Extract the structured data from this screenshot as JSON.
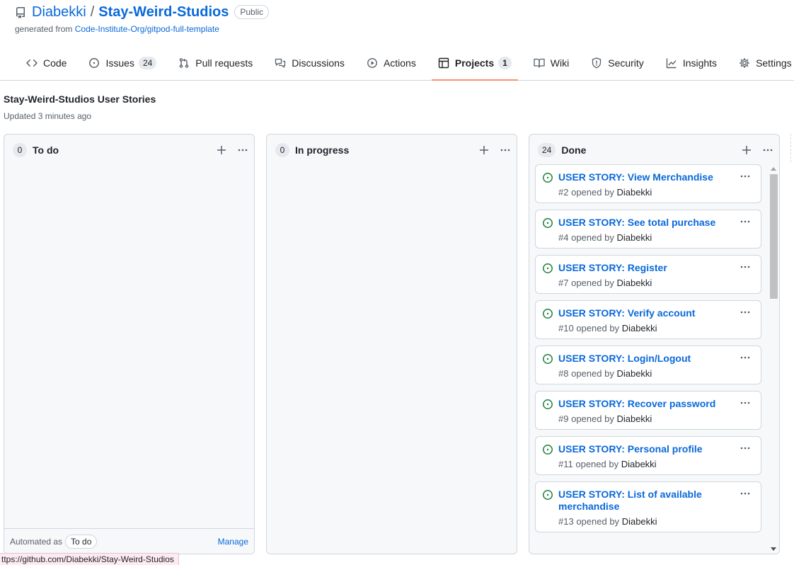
{
  "repo": {
    "owner": "Diabekki",
    "separator": "/",
    "name": "Stay-Weird-Studios",
    "visibility": "Public",
    "generated_prefix": "generated from",
    "generated_from": "Code-Institute-Org/gitpod-full-template"
  },
  "tabs": [
    {
      "label": "Code",
      "icon": "code-icon"
    },
    {
      "label": "Issues",
      "count": "24",
      "icon": "issue-opened-icon"
    },
    {
      "label": "Pull requests",
      "icon": "git-pull-request-icon"
    },
    {
      "label": "Discussions",
      "icon": "comment-discussion-icon"
    },
    {
      "label": "Actions",
      "icon": "play-icon"
    },
    {
      "label": "Projects",
      "count": "1",
      "icon": "table-icon",
      "active": true
    },
    {
      "label": "Wiki",
      "icon": "book-icon"
    },
    {
      "label": "Security",
      "icon": "shield-icon"
    },
    {
      "label": "Insights",
      "icon": "graph-icon"
    },
    {
      "label": "Settings",
      "icon": "gear-icon"
    }
  ],
  "project": {
    "title": "Stay-Weird-Studios User Stories",
    "updated": "Updated 3 minutes ago"
  },
  "columns": [
    {
      "name": "To do",
      "count": "0",
      "automation_label": "Automated as",
      "automation_value": "To do",
      "manage_label": "Manage",
      "cards": []
    },
    {
      "name": "In progress",
      "count": "0",
      "cards": []
    },
    {
      "name": "Done",
      "count": "24",
      "cards": [
        {
          "title": "USER STORY: View Merchandise",
          "number": "#2",
          "opened_by": "opened by",
          "author": "Diabekki"
        },
        {
          "title": "USER STORY: See total purchase",
          "number": "#4",
          "opened_by": "opened by",
          "author": "Diabekki"
        },
        {
          "title": "USER STORY: Register",
          "number": "#7",
          "opened_by": "opened by",
          "author": "Diabekki"
        },
        {
          "title": "USER STORY: Verify account",
          "number": "#10",
          "opened_by": "opened by",
          "author": "Diabekki"
        },
        {
          "title": "USER STORY: Login/Logout",
          "number": "#8",
          "opened_by": "opened by",
          "author": "Diabekki"
        },
        {
          "title": "USER STORY: Recover password",
          "number": "#9",
          "opened_by": "opened by",
          "author": "Diabekki"
        },
        {
          "title": "USER STORY: Personal profile",
          "number": "#11",
          "opened_by": "opened by",
          "author": "Diabekki"
        },
        {
          "title": "USER STORY: List of available merchandise",
          "number": "#13",
          "opened_by": "opened by",
          "author": "Diabekki"
        }
      ]
    }
  ],
  "status_bar": "ttps://github.com/Diabekki/Stay-Weird-Studios",
  "colors": {
    "link": "#0969da",
    "open_issue": "#1a7f37",
    "active_tab_underline": "#fd8c73"
  }
}
